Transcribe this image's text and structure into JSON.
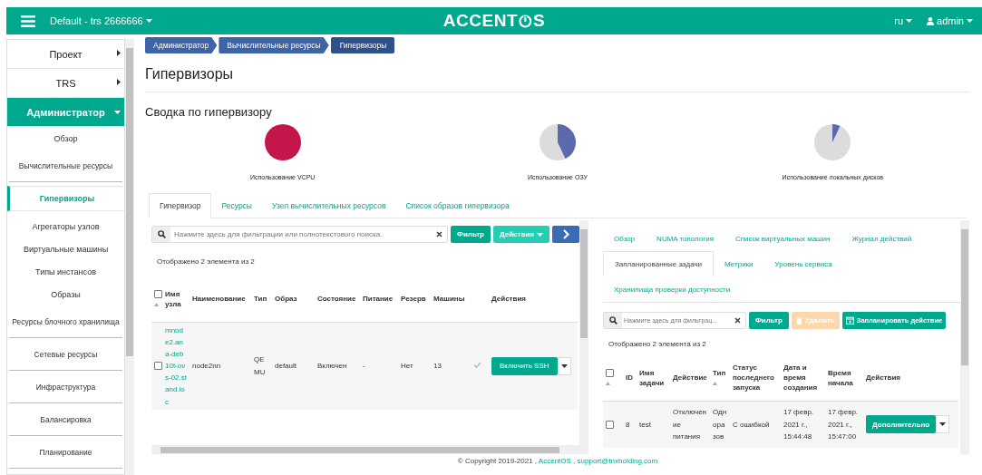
{
  "header": {
    "project": "Default - trs 2666666",
    "logo_start": "ACCENT",
    "logo_end": "S",
    "language": "ru",
    "user": "admin"
  },
  "sidebar": {
    "items": [
      {
        "label": "Проект",
        "expanded": false,
        "selected": false
      },
      {
        "label": "TRS",
        "expanded": false,
        "selected": false
      },
      {
        "label": "Администратор",
        "expanded": true,
        "selected": true,
        "children": [
          {
            "label": "Обзор",
            "selected": false
          },
          {
            "label": "Вычислительные ресурсы",
            "selected": false,
            "children": [
              {
                "label": "Гипервизоры",
                "selected": true
              },
              {
                "label": "Агрегаторы узлов",
                "selected": false
              },
              {
                "label": "Виртуальные машины",
                "selected": false
              },
              {
                "label": "Типы инстансов",
                "selected": false
              },
              {
                "label": "Образы",
                "selected": false
              }
            ]
          },
          {
            "label": "Ресурсы блочного хранилища",
            "selected": false
          },
          {
            "label": "Сетевые ресурсы",
            "selected": false
          },
          {
            "label": "Инфраструктура",
            "selected": false
          },
          {
            "label": "Балансировка",
            "selected": false
          },
          {
            "label": "Планирование",
            "selected": false
          }
        ]
      }
    ]
  },
  "breadcrumb": [
    "Администратор",
    "Вычислительные ресурсы",
    "Гипервизоры"
  ],
  "page_title": "Гипервизоры",
  "summary": {
    "title": "Сводка по гипервизору",
    "charts": [
      {
        "label": "Использование VCPU"
      },
      {
        "label": "Использование ОЗУ"
      },
      {
        "label": "Использование локальных дисков"
      }
    ]
  },
  "tabs": [
    {
      "label": "Гипервизор",
      "selected": true
    },
    {
      "label": "Ресурсы",
      "selected": false
    },
    {
      "label": "Узел вычислительных ресурсов",
      "selected": false
    },
    {
      "label": "Список образов гипервизора",
      "selected": false
    }
  ],
  "hypervisors": {
    "search_placeholder": "Нажмите здесь для фильтрации или полнотекстового поиска.",
    "filter_button": "Фильтр",
    "actions_button": "Действия",
    "count": "Отображено 2 элемента из 2",
    "columns": [
      "Имя узла",
      "Наименование",
      "Тип",
      "Образ",
      "Состояние",
      "Питание",
      "Резерв",
      "Машины",
      "Действия"
    ],
    "header_checked": false,
    "rows": [
      {
        "checked": false,
        "node": "mnode2.ana-deb10t-ovs-02.stand.loc",
        "name": "node2nn",
        "type": "QEMU",
        "image": "default",
        "state": "Включен",
        "power": "-",
        "reserve": "Нет",
        "machines": "13",
        "action": "Включить SSH"
      }
    ]
  },
  "details": {
    "tabs": [
      {
        "label": "Обзор",
        "selected": false
      },
      {
        "label": "NUMA топология",
        "selected": false
      },
      {
        "label": "Список виртуальных машин",
        "selected": false
      },
      {
        "label": "Журнал действий",
        "selected": false
      },
      {
        "label": "Запланированные задачи",
        "selected": true
      },
      {
        "label": "Метрики",
        "selected": false
      },
      {
        "label": "Уровень сервиса",
        "selected": false
      },
      {
        "label": "Хранилища проверки доступности",
        "selected": false
      }
    ],
    "search_placeholder": "Нажмите здесь для фильтрац...",
    "filter_button": "Фильтр",
    "delete_button": "Удалить",
    "delete_disabled": true,
    "schedule_button": "Запланировать действие",
    "count": "Отображено 2 элемента из 2",
    "columns": [
      "ID",
      "Имя задачи",
      "Действие",
      "Тип",
      "Статус последнего запуска",
      "Дата и время создания",
      "Время начала",
      "Действия"
    ],
    "header_checked": false,
    "rows": [
      {
        "checked": false,
        "id": "8",
        "name": "test",
        "action": "Отключение питания",
        "type": "Одноразов",
        "status": "С ошибкой",
        "created": "17 февр. 2021 г., 15:44:48",
        "start": "17 февр. 2021 г., 15:47:00",
        "button": "Дополнительно"
      }
    ]
  },
  "footer": {
    "copyright": "© Copyright 2019-2021 ,",
    "product": "AccentOS",
    "separator": ",",
    "email": "support@tnxholding.com"
  }
}
